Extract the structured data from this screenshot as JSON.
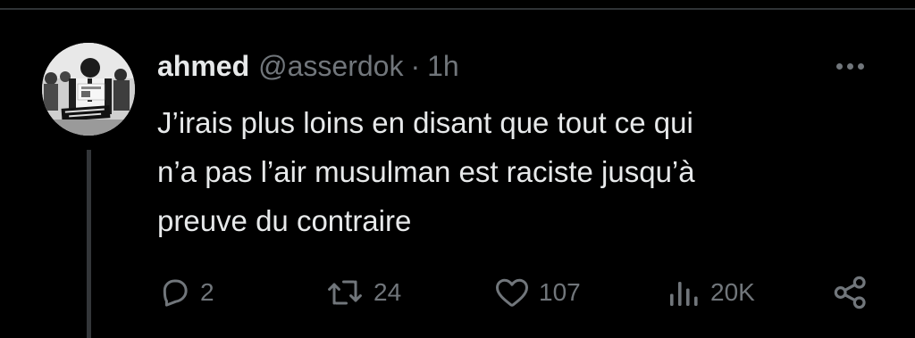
{
  "tweet": {
    "display_name": "ahmed",
    "handle": "@asserdok",
    "separator": "·",
    "time": "1h",
    "text_lines": [
      "J’irais plus loins en disant que tout ce qui",
      "n’a pas l’air musulman est raciste jusqu’à",
      "preuve du contraire"
    ],
    "avatar": {
      "description_icon": "avatar-photo",
      "sign_text": "ALLAH IS THE GREATEST"
    }
  },
  "actions": {
    "reply": {
      "icon": "reply-icon",
      "count": "2"
    },
    "repost": {
      "icon": "repost-icon",
      "count": "24"
    },
    "like": {
      "icon": "heart-icon",
      "count": "107"
    },
    "views": {
      "icon": "views-icon",
      "count": "20K"
    },
    "share": {
      "icon": "share-icon"
    }
  },
  "colors": {
    "background": "#000000",
    "primary_text": "#e7e9ea",
    "secondary_text": "#71767b",
    "divider": "#2f3336"
  }
}
